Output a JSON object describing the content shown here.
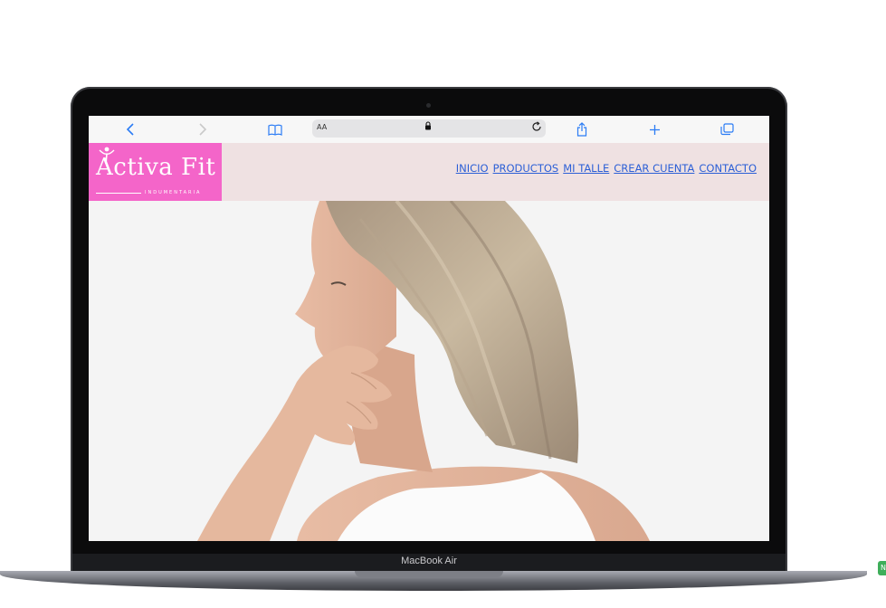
{
  "device": {
    "label": "MacBook Air"
  },
  "browser": {
    "toolbar": {
      "back_icon": "chevron-left-icon",
      "forward_icon": "chevron-right-icon",
      "bookmarks_icon": "book-icon",
      "share_icon": "share-icon",
      "new_tab_icon": "plus-icon",
      "tabs_icon": "tabs-icon"
    },
    "address_bar": {
      "reader_label": "AA",
      "lock_icon": "lock-icon",
      "reload_icon": "reload-icon"
    }
  },
  "site": {
    "logo": {
      "text": "Activa Fit",
      "subtitle": "INDUMENTARIA",
      "color": "#f465c9"
    },
    "header_bg": "#efe1e2",
    "nav": [
      "INICIO",
      "PRODUCTOS",
      "MI TALLE",
      "CREAR CUENTA",
      "CONTACTO"
    ],
    "link_color": "#2c5fd6",
    "hero": {
      "image": "woman-profile-photo"
    }
  },
  "side_badge": "N"
}
